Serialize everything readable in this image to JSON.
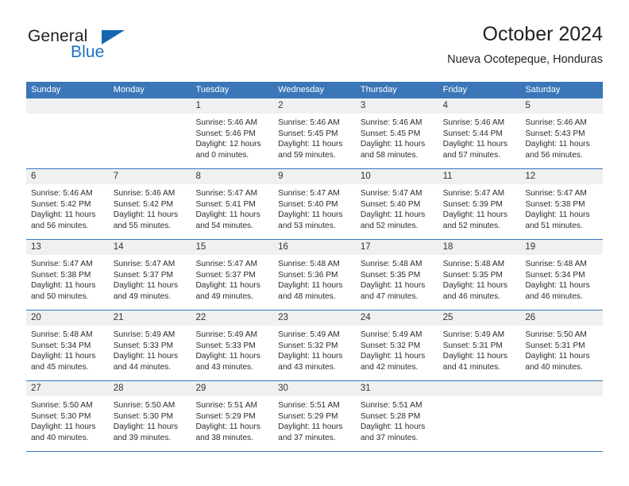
{
  "logo": {
    "word_primary": "General",
    "word_secondary": "Blue",
    "triangle_icon": "triangle-icon"
  },
  "header": {
    "title": "October 2024",
    "subtitle": "Nueva Ocotepeque, Honduras"
  },
  "colors": {
    "header_blue": "#3a76b8",
    "logo_blue": "#1b72bd",
    "day_band": "#f0f0f0",
    "text": "#2c2c2c"
  },
  "calendar": {
    "day_names": [
      "Sunday",
      "Monday",
      "Tuesday",
      "Wednesday",
      "Thursday",
      "Friday",
      "Saturday"
    ],
    "weeks": [
      [
        {
          "day": "",
          "lines": []
        },
        {
          "day": "",
          "lines": []
        },
        {
          "day": "1",
          "lines": [
            "Sunrise: 5:46 AM",
            "Sunset: 5:46 PM",
            "Daylight: 12 hours",
            "and 0 minutes."
          ]
        },
        {
          "day": "2",
          "lines": [
            "Sunrise: 5:46 AM",
            "Sunset: 5:45 PM",
            "Daylight: 11 hours",
            "and 59 minutes."
          ]
        },
        {
          "day": "3",
          "lines": [
            "Sunrise: 5:46 AM",
            "Sunset: 5:45 PM",
            "Daylight: 11 hours",
            "and 58 minutes."
          ]
        },
        {
          "day": "4",
          "lines": [
            "Sunrise: 5:46 AM",
            "Sunset: 5:44 PM",
            "Daylight: 11 hours",
            "and 57 minutes."
          ]
        },
        {
          "day": "5",
          "lines": [
            "Sunrise: 5:46 AM",
            "Sunset: 5:43 PM",
            "Daylight: 11 hours",
            "and 56 minutes."
          ]
        }
      ],
      [
        {
          "day": "6",
          "lines": [
            "Sunrise: 5:46 AM",
            "Sunset: 5:42 PM",
            "Daylight: 11 hours",
            "and 56 minutes."
          ]
        },
        {
          "day": "7",
          "lines": [
            "Sunrise: 5:46 AM",
            "Sunset: 5:42 PM",
            "Daylight: 11 hours",
            "and 55 minutes."
          ]
        },
        {
          "day": "8",
          "lines": [
            "Sunrise: 5:47 AM",
            "Sunset: 5:41 PM",
            "Daylight: 11 hours",
            "and 54 minutes."
          ]
        },
        {
          "day": "9",
          "lines": [
            "Sunrise: 5:47 AM",
            "Sunset: 5:40 PM",
            "Daylight: 11 hours",
            "and 53 minutes."
          ]
        },
        {
          "day": "10",
          "lines": [
            "Sunrise: 5:47 AM",
            "Sunset: 5:40 PM",
            "Daylight: 11 hours",
            "and 52 minutes."
          ]
        },
        {
          "day": "11",
          "lines": [
            "Sunrise: 5:47 AM",
            "Sunset: 5:39 PM",
            "Daylight: 11 hours",
            "and 52 minutes."
          ]
        },
        {
          "day": "12",
          "lines": [
            "Sunrise: 5:47 AM",
            "Sunset: 5:38 PM",
            "Daylight: 11 hours",
            "and 51 minutes."
          ]
        }
      ],
      [
        {
          "day": "13",
          "lines": [
            "Sunrise: 5:47 AM",
            "Sunset: 5:38 PM",
            "Daylight: 11 hours",
            "and 50 minutes."
          ]
        },
        {
          "day": "14",
          "lines": [
            "Sunrise: 5:47 AM",
            "Sunset: 5:37 PM",
            "Daylight: 11 hours",
            "and 49 minutes."
          ]
        },
        {
          "day": "15",
          "lines": [
            "Sunrise: 5:47 AM",
            "Sunset: 5:37 PM",
            "Daylight: 11 hours",
            "and 49 minutes."
          ]
        },
        {
          "day": "16",
          "lines": [
            "Sunrise: 5:48 AM",
            "Sunset: 5:36 PM",
            "Daylight: 11 hours",
            "and 48 minutes."
          ]
        },
        {
          "day": "17",
          "lines": [
            "Sunrise: 5:48 AM",
            "Sunset: 5:35 PM",
            "Daylight: 11 hours",
            "and 47 minutes."
          ]
        },
        {
          "day": "18",
          "lines": [
            "Sunrise: 5:48 AM",
            "Sunset: 5:35 PM",
            "Daylight: 11 hours",
            "and 46 minutes."
          ]
        },
        {
          "day": "19",
          "lines": [
            "Sunrise: 5:48 AM",
            "Sunset: 5:34 PM",
            "Daylight: 11 hours",
            "and 46 minutes."
          ]
        }
      ],
      [
        {
          "day": "20",
          "lines": [
            "Sunrise: 5:48 AM",
            "Sunset: 5:34 PM",
            "Daylight: 11 hours",
            "and 45 minutes."
          ]
        },
        {
          "day": "21",
          "lines": [
            "Sunrise: 5:49 AM",
            "Sunset: 5:33 PM",
            "Daylight: 11 hours",
            "and 44 minutes."
          ]
        },
        {
          "day": "22",
          "lines": [
            "Sunrise: 5:49 AM",
            "Sunset: 5:33 PM",
            "Daylight: 11 hours",
            "and 43 minutes."
          ]
        },
        {
          "day": "23",
          "lines": [
            "Sunrise: 5:49 AM",
            "Sunset: 5:32 PM",
            "Daylight: 11 hours",
            "and 43 minutes."
          ]
        },
        {
          "day": "24",
          "lines": [
            "Sunrise: 5:49 AM",
            "Sunset: 5:32 PM",
            "Daylight: 11 hours",
            "and 42 minutes."
          ]
        },
        {
          "day": "25",
          "lines": [
            "Sunrise: 5:49 AM",
            "Sunset: 5:31 PM",
            "Daylight: 11 hours",
            "and 41 minutes."
          ]
        },
        {
          "day": "26",
          "lines": [
            "Sunrise: 5:50 AM",
            "Sunset: 5:31 PM",
            "Daylight: 11 hours",
            "and 40 minutes."
          ]
        }
      ],
      [
        {
          "day": "27",
          "lines": [
            "Sunrise: 5:50 AM",
            "Sunset: 5:30 PM",
            "Daylight: 11 hours",
            "and 40 minutes."
          ]
        },
        {
          "day": "28",
          "lines": [
            "Sunrise: 5:50 AM",
            "Sunset: 5:30 PM",
            "Daylight: 11 hours",
            "and 39 minutes."
          ]
        },
        {
          "day": "29",
          "lines": [
            "Sunrise: 5:51 AM",
            "Sunset: 5:29 PM",
            "Daylight: 11 hours",
            "and 38 minutes."
          ]
        },
        {
          "day": "30",
          "lines": [
            "Sunrise: 5:51 AM",
            "Sunset: 5:29 PM",
            "Daylight: 11 hours",
            "and 37 minutes."
          ]
        },
        {
          "day": "31",
          "lines": [
            "Sunrise: 5:51 AM",
            "Sunset: 5:28 PM",
            "Daylight: 11 hours",
            "and 37 minutes."
          ]
        },
        {
          "day": "",
          "lines": []
        },
        {
          "day": "",
          "lines": []
        }
      ]
    ]
  }
}
